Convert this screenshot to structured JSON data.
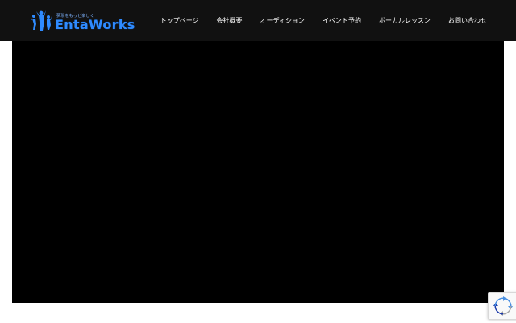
{
  "header": {
    "logo": {
      "tagline": "夢現をもっと楽しく",
      "name": "EntaWorks",
      "brand_color": "#2f8bff"
    },
    "nav": [
      {
        "label": "トップページ"
      },
      {
        "label": "会社概要"
      },
      {
        "label": "オーディション"
      },
      {
        "label": "イベント予約"
      },
      {
        "label": "ボーカルレッスン"
      },
      {
        "label": "お問い合わせ"
      }
    ],
    "background": "#111111"
  },
  "main": {
    "video_background": "#000000"
  },
  "recaptcha": {
    "icon": "recaptcha-icon"
  }
}
